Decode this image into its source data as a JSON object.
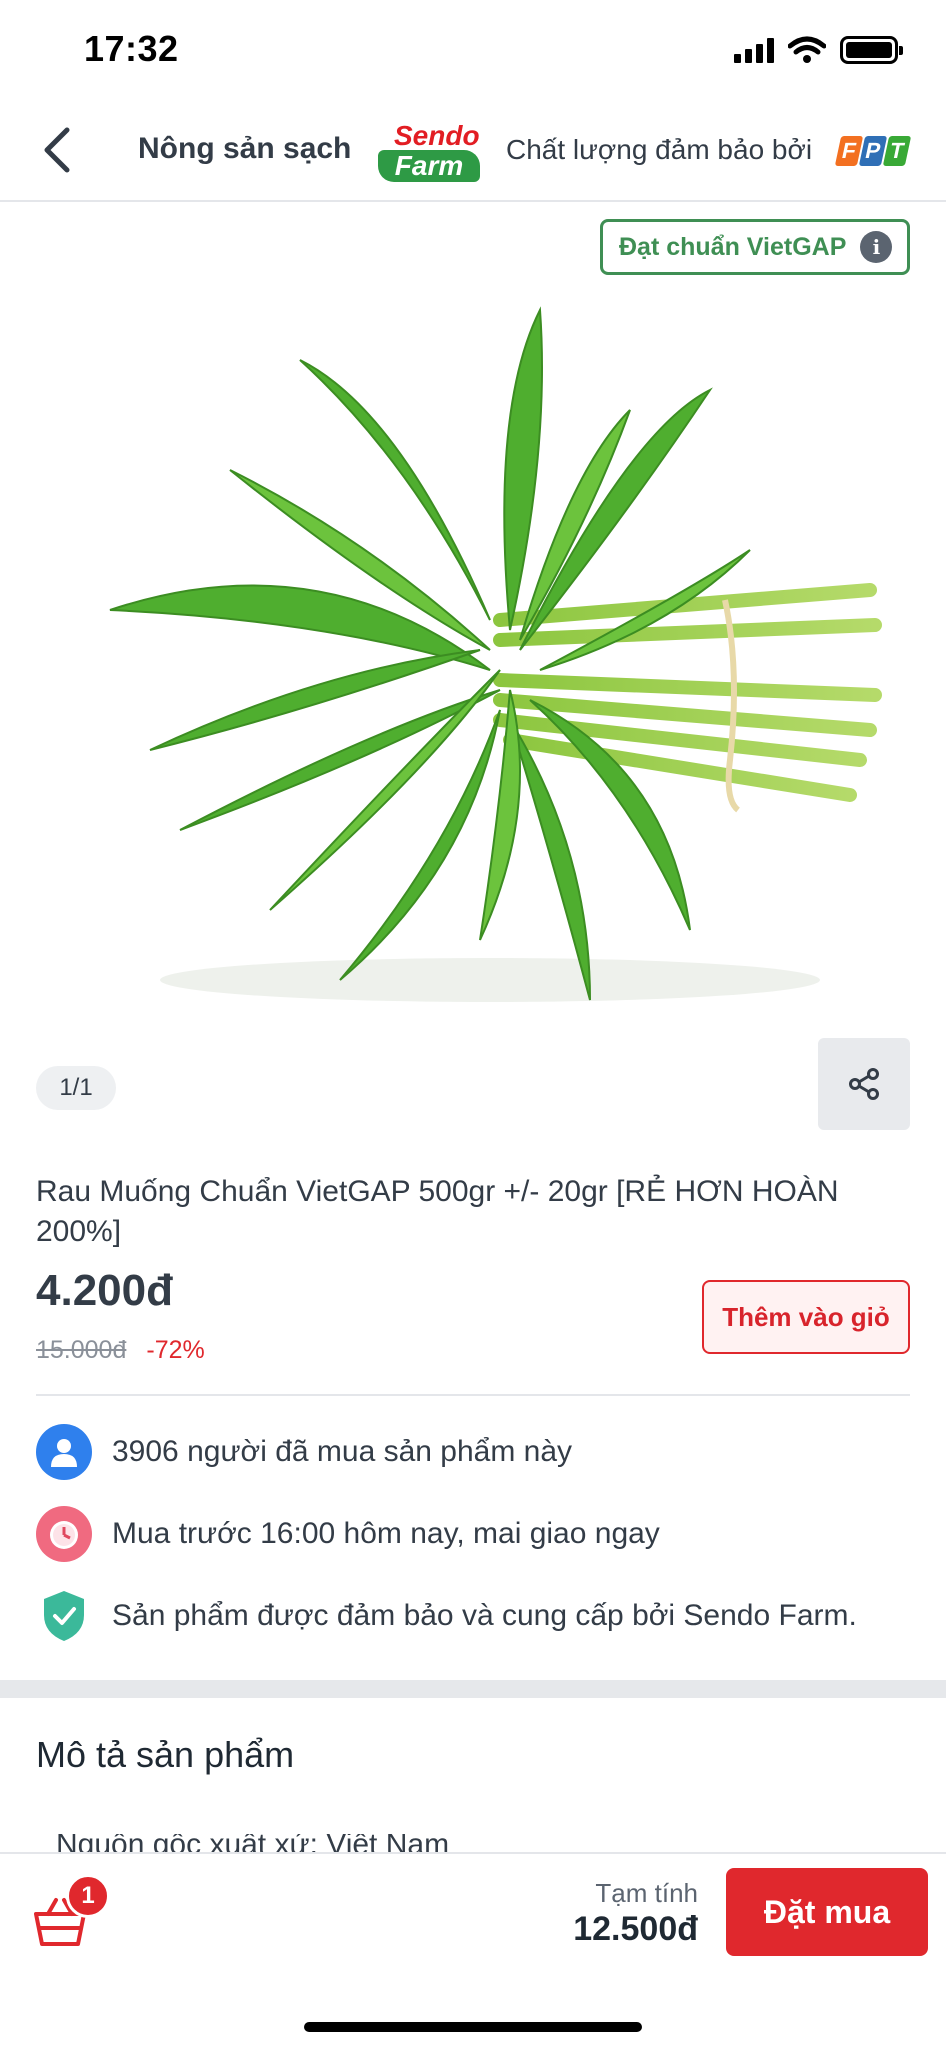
{
  "status_bar": {
    "time": "17:32"
  },
  "header": {
    "title": "Nông sản sạch",
    "logo_top": "Sendo",
    "logo_bottom": "Farm",
    "quality_text": "Chất lượng đảm bảo bởi",
    "fpt_letters": [
      "F",
      "P",
      "T"
    ],
    "fpt_colors": [
      "#f37021",
      "#2f6fb6",
      "#39a936"
    ]
  },
  "badge": {
    "label": "Đạt chuẩn VietGAP",
    "info_glyph": "i"
  },
  "gallery": {
    "counter": "1/1"
  },
  "product": {
    "name": "Rau Muống Chuẩn VietGAP 500gr +/- 20gr [RẺ HƠN HOÀN 200%]",
    "price": "4.200đ",
    "old_price": "15.000đ",
    "discount": "-72%",
    "add_to_cart_label": "Thêm vào giỏ"
  },
  "benefits": [
    {
      "icon": "user-icon",
      "text": "3906 người đã mua sản phẩm này"
    },
    {
      "icon": "clock-icon",
      "text": "Mua trước 16:00 hôm nay, mai giao ngay"
    },
    {
      "icon": "shield-check-icon",
      "text": "Sản phẩm được đảm bảo và cung cấp bởi Sendo Farm."
    }
  ],
  "description": {
    "title": "Mô tả sản phẩm",
    "first_line": "Nguồn gốc xuất xứ: Việt Nam"
  },
  "bottom_bar": {
    "cart_count": "1",
    "subtotal_label": "Tạm tính",
    "subtotal_value": "12.500đ",
    "order_label": "Đặt mua"
  },
  "colors": {
    "accent_red": "#e0282d",
    "vietgap_green": "#3f8f54",
    "sendo_green": "#2e9a45"
  }
}
